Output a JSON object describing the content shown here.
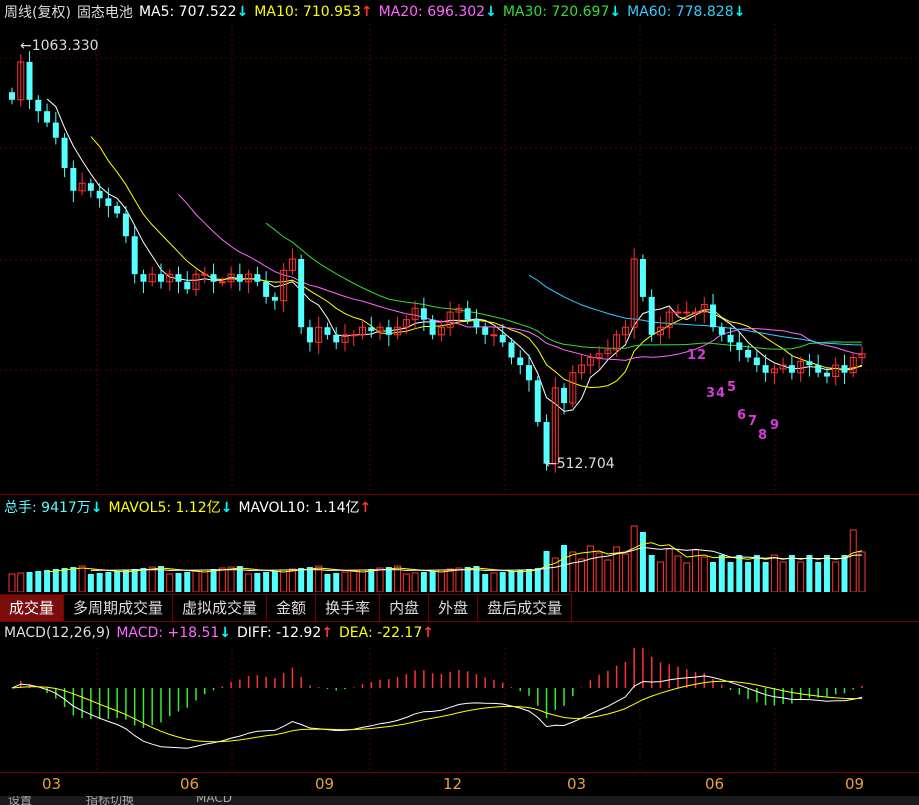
{
  "price_legend": {
    "period": "周线(复权)",
    "name": "固态电池",
    "ma5": {
      "label": "MA5: 707.522",
      "arrow": "↓",
      "color": "#ffffff",
      "arrow_color": "#00ffff"
    },
    "ma10": {
      "label": "MA10: 710.953",
      "arrow": "↑",
      "color": "#ffff00",
      "arrow_color": "#ff3333"
    },
    "ma20": {
      "label": "MA20: 696.302",
      "arrow": "↓",
      "color": "#ff66ff",
      "arrow_color": "#00ffff"
    },
    "ma30": {
      "label": "MA30: 720.697",
      "arrow": "↓",
      "color": "#33dd33",
      "arrow_color": "#00ffff"
    },
    "ma60": {
      "label": "MA60: 778.828",
      "arrow": "↓",
      "color": "#33ccff",
      "arrow_color": "#00ffff"
    }
  },
  "annotations": {
    "high": "1063.330",
    "low": "512.704"
  },
  "countdown": [
    "1",
    "2",
    "3",
    "4",
    "5",
    "6",
    "7",
    "8",
    "9"
  ],
  "volume_legend": {
    "total": {
      "label": "总手: 9417万",
      "arrow": "↓"
    },
    "mavol5": {
      "label": "MAVOL5: 1.12亿",
      "arrow": "↓"
    },
    "mavol10": {
      "label": "MAVOL10: 1.14亿",
      "arrow": "↑"
    }
  },
  "tabs": [
    "成交量",
    "多周期成交量",
    "虚拟成交量",
    "金额",
    "换手率",
    "内盘",
    "外盘",
    "盘后成交量"
  ],
  "macd_legend": {
    "name": "MACD(12,26,9)",
    "macd": {
      "label": "MACD: +18.51",
      "arrow": "↓"
    },
    "diff": {
      "label": "DIFF: -12.92",
      "arrow": "↑"
    },
    "dea": {
      "label": "DEA: -22.17",
      "arrow": "↑"
    }
  },
  "x_ticks": [
    "03",
    "06",
    "09",
    "12",
    "03",
    "06",
    "09"
  ],
  "bottom_bar": [
    "设置",
    "指标切换",
    "MACD"
  ],
  "colors": {
    "up": "#ff3232",
    "down": "#54ffff",
    "grid": "#5a0000",
    "axis_label": "#e6a13a"
  },
  "chart_data": {
    "type": "candlestick",
    "title": "固态电池",
    "x_ticks": [
      "03",
      "06",
      "09",
      "12",
      "03",
      "06",
      "09"
    ],
    "ylim": [
      480,
      1100
    ],
    "closes": [
      1000,
      1050,
      1000,
      985,
      970,
      950,
      910,
      880,
      890,
      880,
      870,
      860,
      850,
      820,
      770,
      760,
      770,
      760,
      770,
      760,
      750,
      770,
      770,
      760,
      760,
      770,
      760,
      770,
      760,
      740,
      735,
      775,
      790,
      700,
      680,
      700,
      690,
      680,
      690,
      690,
      700,
      695,
      700,
      690,
      700,
      710,
      725,
      710,
      690,
      700,
      720,
      725,
      710,
      700,
      690,
      690,
      680,
      660,
      650,
      630,
      575,
      520,
      620,
      600,
      640,
      650,
      660,
      665,
      670,
      690,
      700,
      790,
      740,
      690,
      700,
      720,
      720,
      720,
      720,
      730,
      700,
      690,
      680,
      670,
      660,
      650,
      640,
      645,
      650,
      640,
      655,
      650,
      640,
      635,
      650,
      640,
      660,
      665
    ],
    "series": [
      {
        "name": "MA5",
        "values": []
      },
      {
        "name": "MA10",
        "values": []
      },
      {
        "name": "MA20",
        "values": []
      },
      {
        "name": "MA30",
        "values": []
      },
      {
        "name": "MA60",
        "values": []
      }
    ]
  }
}
